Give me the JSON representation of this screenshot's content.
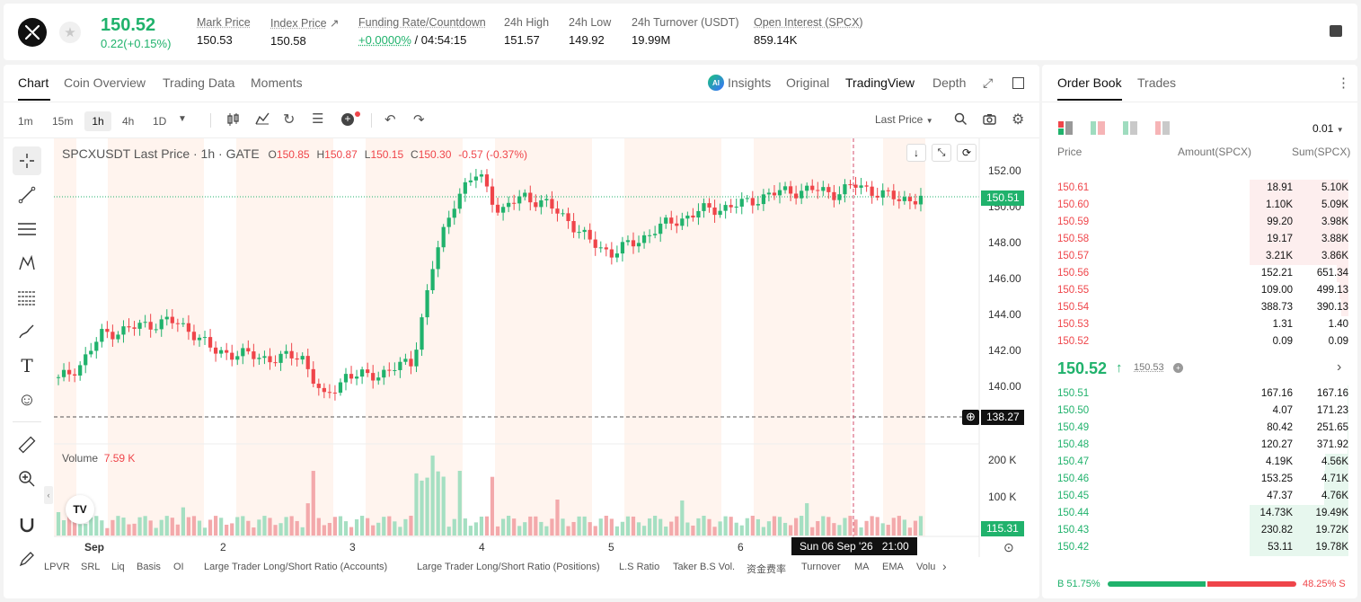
{
  "ticker": {
    "last_price": "150.52",
    "change": "0.22(+0.15%)",
    "stats": [
      {
        "label": "Mark Price",
        "value": "150.53"
      },
      {
        "label": "Index Price",
        "value": "150.58"
      },
      {
        "label": "Funding Rate/Countdown",
        "value": "+0.0000%",
        "value2": " / 04:54:15"
      },
      {
        "label": "24h High",
        "value": "151.57"
      },
      {
        "label": "24h Low",
        "value": "149.92"
      },
      {
        "label": "24h Turnover (USDT)",
        "value": "19.99M"
      },
      {
        "label": "Open Interest (SPCX)",
        "value": "859.14K"
      }
    ]
  },
  "chart_tabs": {
    "chart": "Chart",
    "coin_overview": "Coin Overview",
    "trading_data": "Trading Data",
    "moments": "Moments"
  },
  "view_tabs": {
    "insights": "Insights",
    "original": "Original",
    "tradingview": "TradingView",
    "depth": "Depth"
  },
  "ai_badge": "AI",
  "timeframes": [
    "1m",
    "15m",
    "1h",
    "4h",
    "1D"
  ],
  "price_type": "Last Price",
  "legend": {
    "title": "SPCXUSDT Last Price · 1h · GATE",
    "o_label": "O",
    "o": "150.85",
    "h_label": "H",
    "h": "150.87",
    "l_label": "L",
    "l": "150.15",
    "c_label": "C",
    "c": "150.30",
    "chg": "-0.57 (-0.37%)"
  },
  "volume_legend": {
    "label": "Volume",
    "value": "7.59 K"
  },
  "price_axis": [
    "152.00",
    "150.00",
    "148.00",
    "146.00",
    "144.00",
    "142.00",
    "140.00"
  ],
  "current_price_tag": "150.51",
  "crosshair_price_tag": "138.27",
  "volume_axis": [
    "200 K",
    "100 K"
  ],
  "volume_tag": "115.31",
  "time_axis": [
    "Sep",
    "2",
    "3",
    "4",
    "5",
    "6"
  ],
  "crosshair_time_tag": "Sun 06 Sep '26   21:00",
  "tv_logo": "TV",
  "indicators": [
    "LPVR",
    "SRL",
    "Liq",
    "Basis",
    "OI",
    "Large Trader Long/Short Ratio (Accounts)",
    "Large Trader Long/Short Ratio (Positions)",
    "L.S Ratio",
    "Taker B.S Vol.",
    "资金费率",
    "Turnover",
    "MA",
    "EMA",
    "Volu"
  ],
  "orderbook": {
    "tabs": {
      "order_book": "Order Book",
      "trades": "Trades"
    },
    "precision": "0.01",
    "headers": {
      "price": "Price",
      "amount": "Amount(SPCX)",
      "sum": "Sum(SPCX)"
    },
    "asks": [
      {
        "price": "150.61",
        "amount": "18.91",
        "sum": "5.10K",
        "depth": 0.98
      },
      {
        "price": "150.60",
        "amount": "1.10K",
        "sum": "5.09K",
        "depth": 0.98
      },
      {
        "price": "150.59",
        "amount": "99.20",
        "sum": "3.98K",
        "depth": 0.98
      },
      {
        "price": "150.58",
        "amount": "19.17",
        "sum": "3.88K",
        "depth": 0.98
      },
      {
        "price": "150.57",
        "amount": "3.21K",
        "sum": "3.86K",
        "depth": 0.98
      },
      {
        "price": "150.56",
        "amount": "152.21",
        "sum": "651.34",
        "depth": 0.12
      },
      {
        "price": "150.55",
        "amount": "109.00",
        "sum": "499.13",
        "depth": 0.09
      },
      {
        "price": "150.54",
        "amount": "388.73",
        "sum": "390.13",
        "depth": 0.07
      },
      {
        "price": "150.53",
        "amount": "1.31",
        "sum": "1.40",
        "depth": 0.0
      },
      {
        "price": "150.52",
        "amount": "0.09",
        "sum": "0.09",
        "depth": 0.0
      }
    ],
    "mid_price": "150.52",
    "mid_mark": "150.53",
    "bids": [
      {
        "price": "150.51",
        "amount": "167.16",
        "sum": "167.16",
        "depth": 0.01
      },
      {
        "price": "150.50",
        "amount": "4.07",
        "sum": "171.23",
        "depth": 0.01
      },
      {
        "price": "150.49",
        "amount": "80.42",
        "sum": "251.65",
        "depth": 0.01
      },
      {
        "price": "150.48",
        "amount": "120.27",
        "sum": "371.92",
        "depth": 0.01
      },
      {
        "price": "150.47",
        "amount": "4.19K",
        "sum": "4.56K",
        "depth": 0.23
      },
      {
        "price": "150.46",
        "amount": "153.25",
        "sum": "4.71K",
        "depth": 0.24
      },
      {
        "price": "150.45",
        "amount": "47.37",
        "sum": "4.76K",
        "depth": 0.24
      },
      {
        "price": "150.44",
        "amount": "14.73K",
        "sum": "19.49K",
        "depth": 0.98
      },
      {
        "price": "150.43",
        "amount": "230.82",
        "sum": "19.72K",
        "depth": 0.98
      },
      {
        "price": "150.42",
        "amount": "53.11",
        "sum": "19.78K",
        "depth": 0.98
      }
    ],
    "ratio": {
      "buy": "B 51.75%",
      "sell": "48.25% S",
      "buy_frac": 0.5175
    }
  },
  "chart_data": {
    "type": "candlestick",
    "title": "SPCXUSDT Last Price · 1h · GATE",
    "x": [
      "Sep",
      "2",
      "3",
      "4",
      "5",
      "6"
    ],
    "ylim": [
      138.27,
      152.0
    ],
    "series": [
      {
        "name": "SPCXUSDT",
        "values": [
          140.3,
          141.2,
          142.9,
          143.1,
          143.4,
          143.6,
          143.1,
          141.9,
          141.8,
          141.6,
          141.5,
          141.7,
          139.2,
          140.6,
          140.5,
          140.9,
          141.3,
          147.0,
          150.6,
          151.8,
          149.6,
          150.6,
          150.1,
          149.3,
          148.0,
          147.4,
          147.9,
          148.7,
          149.2,
          149.7,
          149.9,
          150.1,
          150.6,
          150.8,
          150.9,
          150.7,
          151.1,
          150.8,
          150.3,
          150.5
        ]
      }
    ]
  },
  "colors": {
    "up": "#20b26c",
    "down": "#ef454a",
    "accent": "#20b26c"
  }
}
